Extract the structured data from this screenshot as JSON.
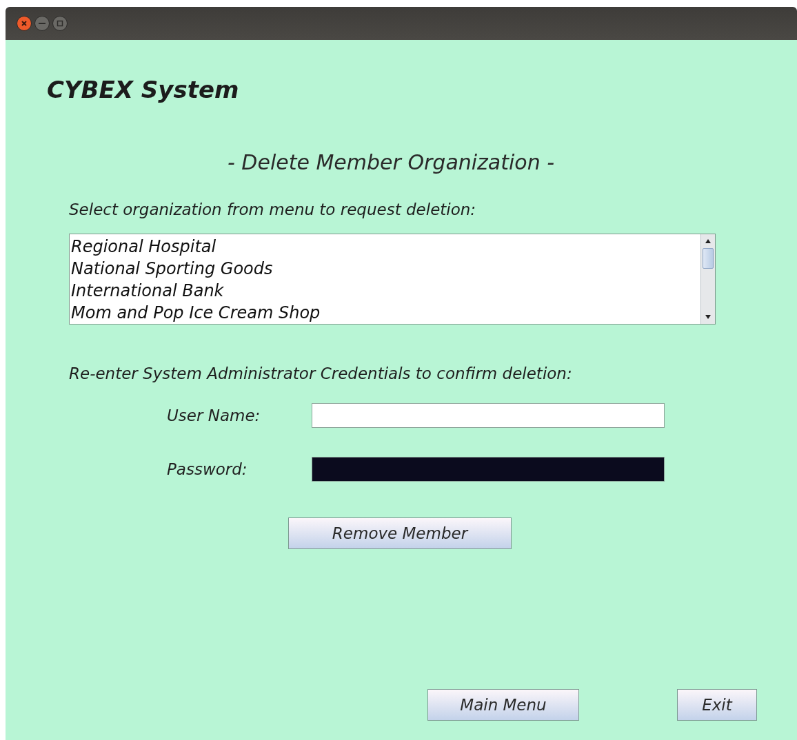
{
  "window": {
    "controls": [
      {
        "kind": "close"
      },
      {
        "kind": "minimize"
      },
      {
        "kind": "maximize"
      }
    ]
  },
  "app_title": "CYBEX System",
  "heading": "- Delete Member Organization -",
  "list_prompt": "Select organization from menu to request deletion:",
  "organizations": [
    {
      "name": "Regional Hospital",
      "selected": false
    },
    {
      "name": "National Sporting Goods",
      "selected": false
    },
    {
      "name": "International Bank",
      "selected": false
    },
    {
      "name": "Mom and Pop Ice Cream Shop",
      "selected": false
    }
  ],
  "credentials_prompt": "Re-enter System Administrator Credentials to confirm deletion:",
  "fields": [
    {
      "label": "User Name:",
      "kind": "text"
    },
    {
      "label": "Password:",
      "kind": "password"
    }
  ],
  "action_button": "Remove Member",
  "footer_buttons": [
    "Main Menu",
    "Exit"
  ]
}
